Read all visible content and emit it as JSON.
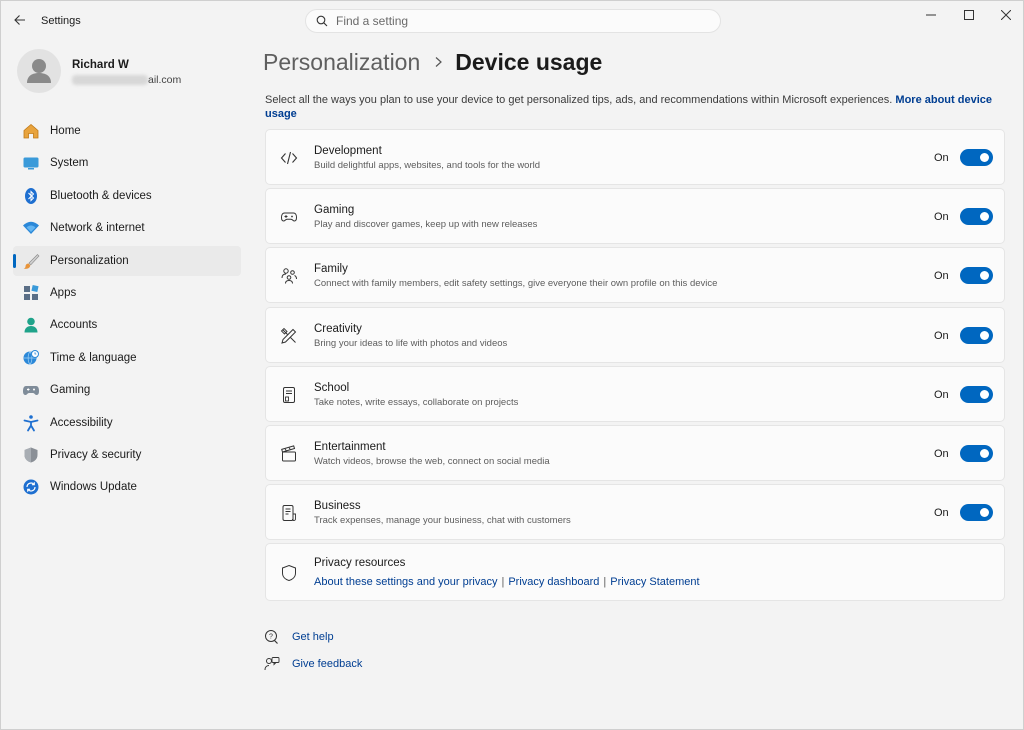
{
  "window": {
    "app_title": "Settings"
  },
  "search": {
    "placeholder": "Find a setting"
  },
  "profile": {
    "name": "Richard W",
    "email_visible": "ail.com"
  },
  "sidebar": {
    "items": [
      {
        "label": "Home",
        "icon": "home-icon"
      },
      {
        "label": "System",
        "icon": "system-icon"
      },
      {
        "label": "Bluetooth & devices",
        "icon": "bluetooth-icon"
      },
      {
        "label": "Network & internet",
        "icon": "wifi-icon"
      },
      {
        "label": "Personalization",
        "icon": "paintbrush-icon",
        "active": true
      },
      {
        "label": "Apps",
        "icon": "apps-icon"
      },
      {
        "label": "Accounts",
        "icon": "accounts-icon"
      },
      {
        "label": "Time & language",
        "icon": "globe-clock-icon"
      },
      {
        "label": "Gaming",
        "icon": "gamepad-icon"
      },
      {
        "label": "Accessibility",
        "icon": "accessibility-icon"
      },
      {
        "label": "Privacy & security",
        "icon": "shield-icon"
      },
      {
        "label": "Windows Update",
        "icon": "update-icon"
      }
    ]
  },
  "header": {
    "parent": "Personalization",
    "current": "Device usage"
  },
  "intro": {
    "text": "Select all the ways you plan to use your device to get personalized tips, ads, and recommendations within Microsoft experiences.",
    "link": "More about device usage"
  },
  "usages": [
    {
      "title": "Development",
      "desc": "Build delightful apps, websites, and tools for the world",
      "state": "On",
      "on": true,
      "icon": "code-icon"
    },
    {
      "title": "Gaming",
      "desc": "Play and discover games, keep up with new releases",
      "state": "On",
      "on": true,
      "icon": "gamepad-icon"
    },
    {
      "title": "Family",
      "desc": "Connect with family members, edit safety settings, give everyone their own profile on this device",
      "state": "On",
      "on": true,
      "icon": "family-icon"
    },
    {
      "title": "Creativity",
      "desc": "Bring your ideas to life with photos and videos",
      "state": "On",
      "on": true,
      "icon": "pen-ruler-icon"
    },
    {
      "title": "School",
      "desc": "Take notes, write essays, collaborate on projects",
      "state": "On",
      "on": true,
      "icon": "notebook-icon"
    },
    {
      "title": "Entertainment",
      "desc": "Watch videos, browse the web, connect on social media",
      "state": "On",
      "on": true,
      "icon": "clapperboard-icon"
    },
    {
      "title": "Business",
      "desc": "Track expenses, manage your business, chat with customers",
      "state": "On",
      "on": true,
      "icon": "document-icon"
    }
  ],
  "privacy": {
    "title": "Privacy resources",
    "links": [
      "About these settings and your privacy",
      "Privacy dashboard",
      "Privacy Statement"
    ],
    "separator": "|"
  },
  "help": {
    "get_help": "Get help",
    "give_feedback": "Give feedback"
  },
  "colors": {
    "accent": "#0067c0",
    "link": "#003e92",
    "background": "#f3f3f3",
    "card": "#fbfbfb"
  }
}
